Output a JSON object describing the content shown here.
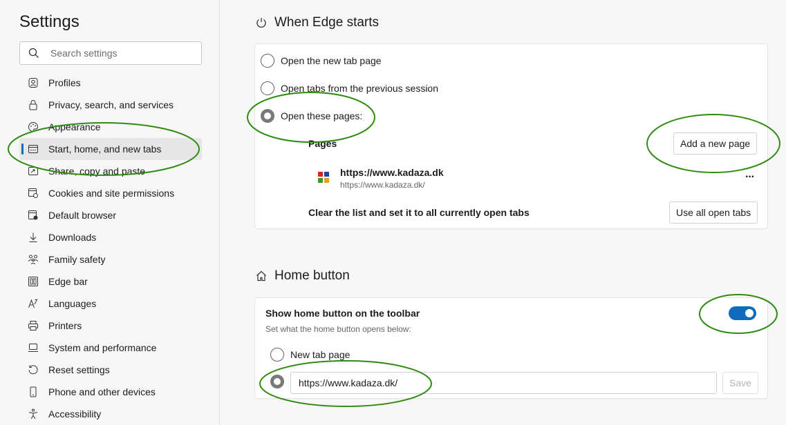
{
  "sidebar": {
    "title": "Settings",
    "search_placeholder": "Search settings",
    "items": [
      {
        "label": "Profiles",
        "icon": "profile-icon"
      },
      {
        "label": "Privacy, search, and services",
        "icon": "lock-icon"
      },
      {
        "label": "Appearance",
        "icon": "palette-icon"
      },
      {
        "label": "Start, home, and new tabs",
        "icon": "start-icon",
        "active": true
      },
      {
        "label": "Share, copy and paste",
        "icon": "share-icon"
      },
      {
        "label": "Cookies and site permissions",
        "icon": "cookies-icon"
      },
      {
        "label": "Default browser",
        "icon": "browser-icon"
      },
      {
        "label": "Downloads",
        "icon": "download-icon"
      },
      {
        "label": "Family safety",
        "icon": "family-icon"
      },
      {
        "label": "Edge bar",
        "icon": "edge-bar-icon"
      },
      {
        "label": "Languages",
        "icon": "languages-icon"
      },
      {
        "label": "Printers",
        "icon": "printer-icon"
      },
      {
        "label": "System and performance",
        "icon": "system-icon"
      },
      {
        "label": "Reset settings",
        "icon": "reset-icon"
      },
      {
        "label": "Phone and other devices",
        "icon": "phone-icon"
      },
      {
        "label": "Accessibility",
        "icon": "accessibility-icon"
      }
    ]
  },
  "when_edge_starts": {
    "title": "When Edge starts",
    "options": [
      {
        "label": "Open the new tab page",
        "checked": false
      },
      {
        "label": "Open tabs from the previous session",
        "checked": false
      },
      {
        "label": "Open these pages:",
        "checked": true
      }
    ],
    "pages_heading": "Pages",
    "add_page_button": "Add a new page",
    "page_entry": {
      "title": "https://www.kadaza.dk",
      "url": "https://www.kadaza.dk/"
    },
    "more_glyph": "···",
    "clear_list_text": "Clear the list and set it to all currently open tabs",
    "use_all_tabs_button": "Use all open tabs"
  },
  "home_button": {
    "title": "Home button",
    "toggle_label": "Show home button on the toolbar",
    "toggle_on": true,
    "description": "Set what the home button opens below:",
    "options": [
      {
        "label": "New tab page",
        "checked": false
      },
      {
        "label": "",
        "checked": true
      }
    ],
    "url_value": "https://www.kadaza.dk/",
    "save_button": "Save"
  },
  "colors": {
    "accent": "#0f6cbd",
    "annotation": "#2e8b12",
    "favicon": [
      "#d42a1e",
      "#2a3fa8",
      "#3a9b2b",
      "#e0a21b"
    ]
  }
}
